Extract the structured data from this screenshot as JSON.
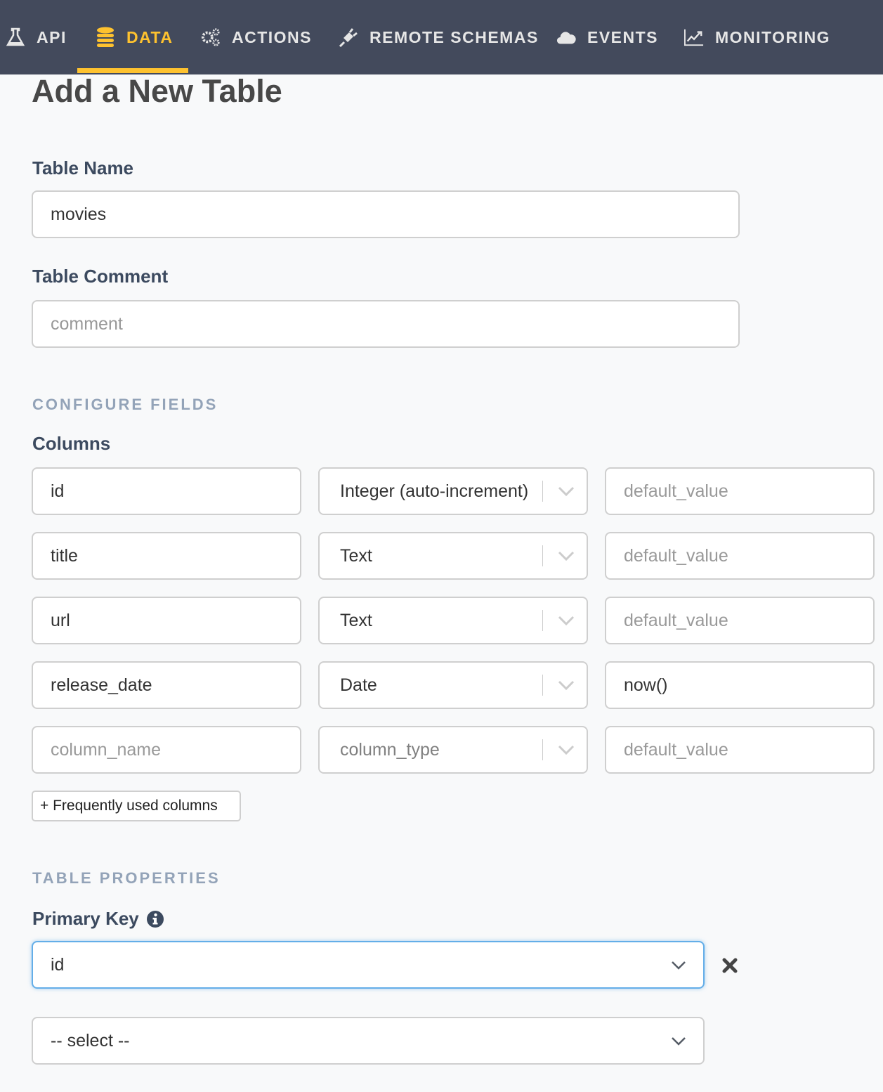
{
  "nav": {
    "items": [
      {
        "label": "API",
        "icon": "flask-icon",
        "active": false
      },
      {
        "label": "DATA",
        "icon": "database-icon",
        "active": true
      },
      {
        "label": "ACTIONS",
        "icon": "cogs-icon",
        "active": false
      },
      {
        "label": "REMOTE SCHEMAS",
        "icon": "plug-icon",
        "active": false
      },
      {
        "label": "EVENTS",
        "icon": "cloud-icon",
        "active": false
      },
      {
        "label": "MONITORING",
        "icon": "line-chart-icon",
        "active": false
      }
    ],
    "accent_color": "#fec22f",
    "background_color": "#434a5c"
  },
  "page": {
    "title": "Add a New Table",
    "table_name_label": "Table Name",
    "table_name_value": "movies",
    "table_comment_label": "Table Comment",
    "table_comment_placeholder": "comment",
    "configure_fields_heading": "CONFIGURE FIELDS",
    "columns_label": "Columns",
    "columns": [
      {
        "name": "id",
        "type": "Integer (auto-increment)",
        "default": "",
        "default_placeholder": "default_value"
      },
      {
        "name": "title",
        "type": "Text",
        "default": "",
        "default_placeholder": "default_value"
      },
      {
        "name": "url",
        "type": "Text",
        "default": "",
        "default_placeholder": "default_value"
      },
      {
        "name": "release_date",
        "type": "Date",
        "default": "now()",
        "default_placeholder": "default_value"
      },
      {
        "name": "",
        "name_placeholder": "column_name",
        "type": "",
        "type_placeholder": "column_type",
        "default": "",
        "default_placeholder": "default_value"
      }
    ],
    "frequently_used_button": "+ Frequently used columns",
    "table_properties_heading": "TABLE PROPERTIES",
    "primary_key_label": "Primary Key",
    "primary_keys": [
      {
        "value": "id"
      },
      {
        "value": "-- select --"
      }
    ]
  }
}
